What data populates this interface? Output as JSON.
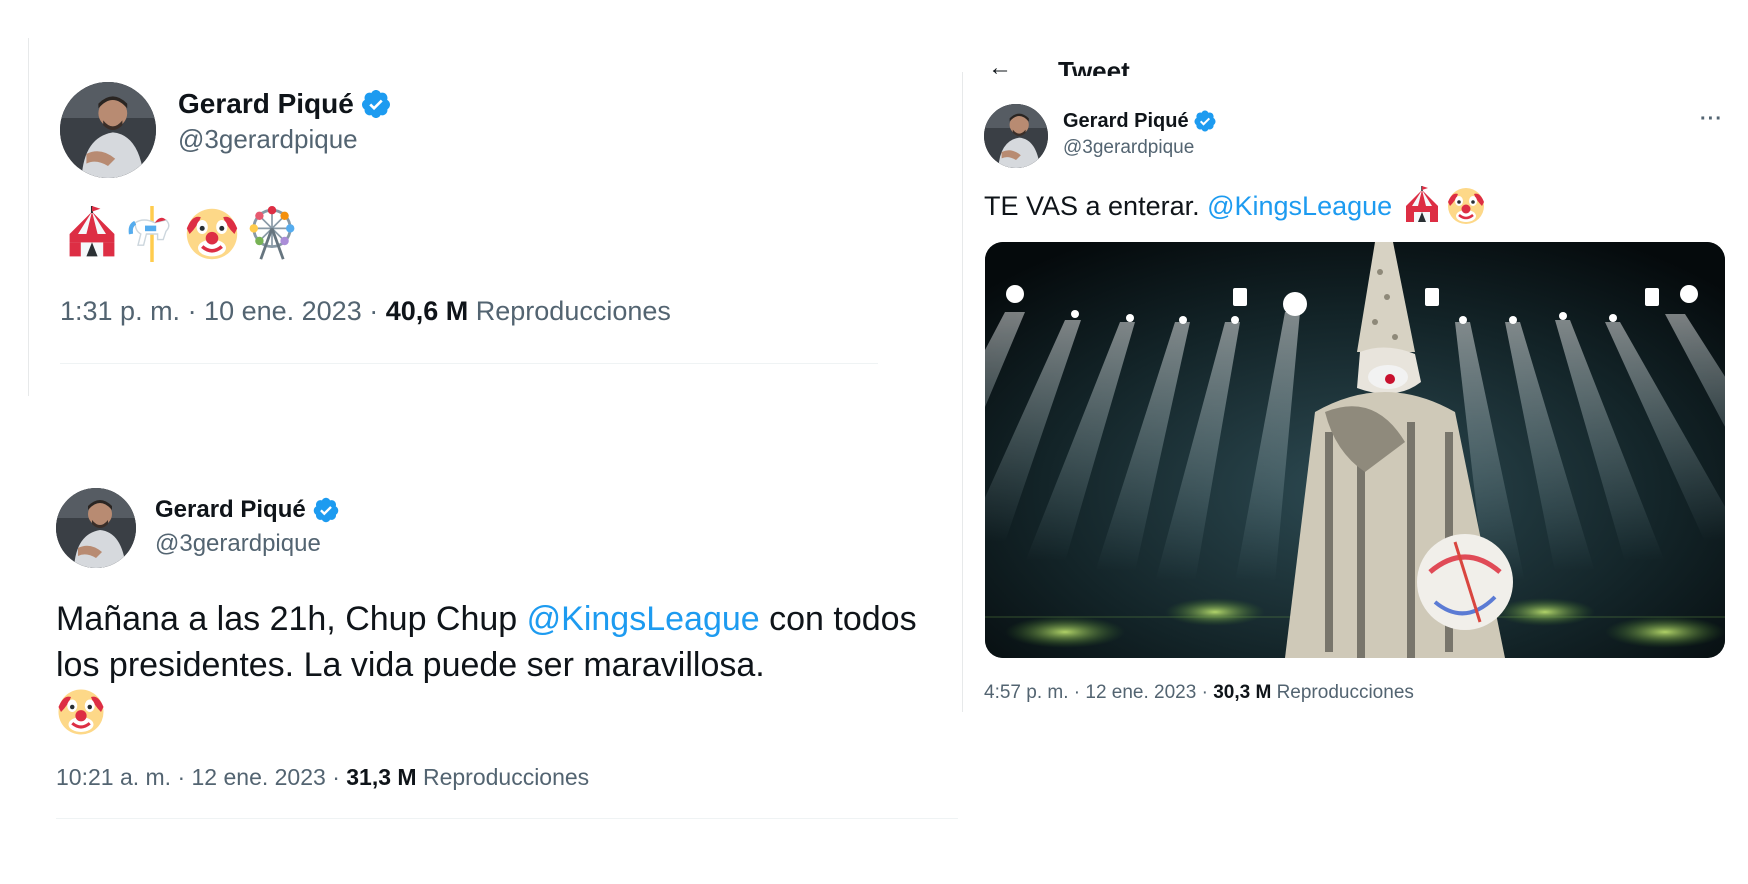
{
  "tweet1": {
    "name": "Gerard Piqué",
    "handle": "@3gerardpique",
    "emojis": [
      "circus-tent-icon",
      "carousel-horse-icon",
      "clown-face-icon",
      "ferris-wheel-icon"
    ],
    "time": "1:31 p. m. · 10 ene. 2023 · ",
    "views": "40,6 M",
    "views_label": "Reproducciones"
  },
  "tweet2": {
    "name": "Gerard Piqué",
    "handle": "@3gerardpique",
    "text_before": "Mañana a las 21h, Chup Chup ",
    "mention": "@KingsLeague",
    "text_after": " con todos los presidentes. La vida puede ser maravillosa.",
    "emojis": [
      "clown-face-icon"
    ],
    "time": "10:21 a. m. · 12 ene. 2023 · ",
    "views": "31,3 M",
    "views_label": "Reproducciones"
  },
  "tweet3": {
    "header_title": "Tweet",
    "name": "Gerard Piqué",
    "handle": "@3gerardpique",
    "more_label": "···",
    "text_before": "TE VAS a enterar. ",
    "mention": "@KingsLeague",
    "emojis": [
      "circus-tent-icon",
      "clown-face-icon"
    ],
    "media": "photo of a masked clown holding a ball on a stage with spotlights",
    "time": "4:57 p. m. · 12 ene. 2023 · ",
    "views": "30,3 M",
    "views_label": "Reproducciones"
  },
  "colors": {
    "accent": "#1d9bf0",
    "text": "#0f1419",
    "secondary": "#536471"
  }
}
